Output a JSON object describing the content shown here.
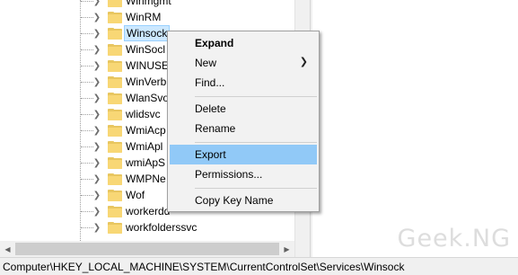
{
  "tree": {
    "items": [
      {
        "label": "Winmgmt",
        "selected": false
      },
      {
        "label": "WinRM",
        "selected": false
      },
      {
        "label": "Winsock",
        "selected": true
      },
      {
        "label": "WinSocl",
        "selected": false
      },
      {
        "label": "WINUSE",
        "selected": false
      },
      {
        "label": "WinVerb",
        "selected": false
      },
      {
        "label": "WlanSvo",
        "selected": false
      },
      {
        "label": "wlidsvc",
        "selected": false
      },
      {
        "label": "WmiAcp",
        "selected": false
      },
      {
        "label": "WmiApl",
        "selected": false
      },
      {
        "label": "wmiApS",
        "selected": false
      },
      {
        "label": "WMPNe",
        "selected": false
      },
      {
        "label": "Wof",
        "selected": false
      },
      {
        "label": "workerdd",
        "selected": false
      },
      {
        "label": "workfolderssvc",
        "selected": false
      }
    ]
  },
  "context_menu": {
    "expand": "Expand",
    "new": "New",
    "find": "Find...",
    "delete": "Delete",
    "rename": "Rename",
    "export": "Export",
    "permissions": "Permissions...",
    "copy_key_name": "Copy Key Name",
    "highlighted_item": "Export"
  },
  "statusbar": {
    "path": "Computer\\HKEY_LOCAL_MACHINE\\SYSTEM\\CurrentControlSet\\Services\\Winsock"
  },
  "watermark": "Geek.NG",
  "icons": {
    "expander": "chevron-right-icon",
    "folder": "folder-icon",
    "submenu": "chevron-right-icon"
  },
  "colors": {
    "selection_bg": "#cce8ff",
    "menu_highlight": "#91c9f7",
    "folder": "#f8d775"
  }
}
